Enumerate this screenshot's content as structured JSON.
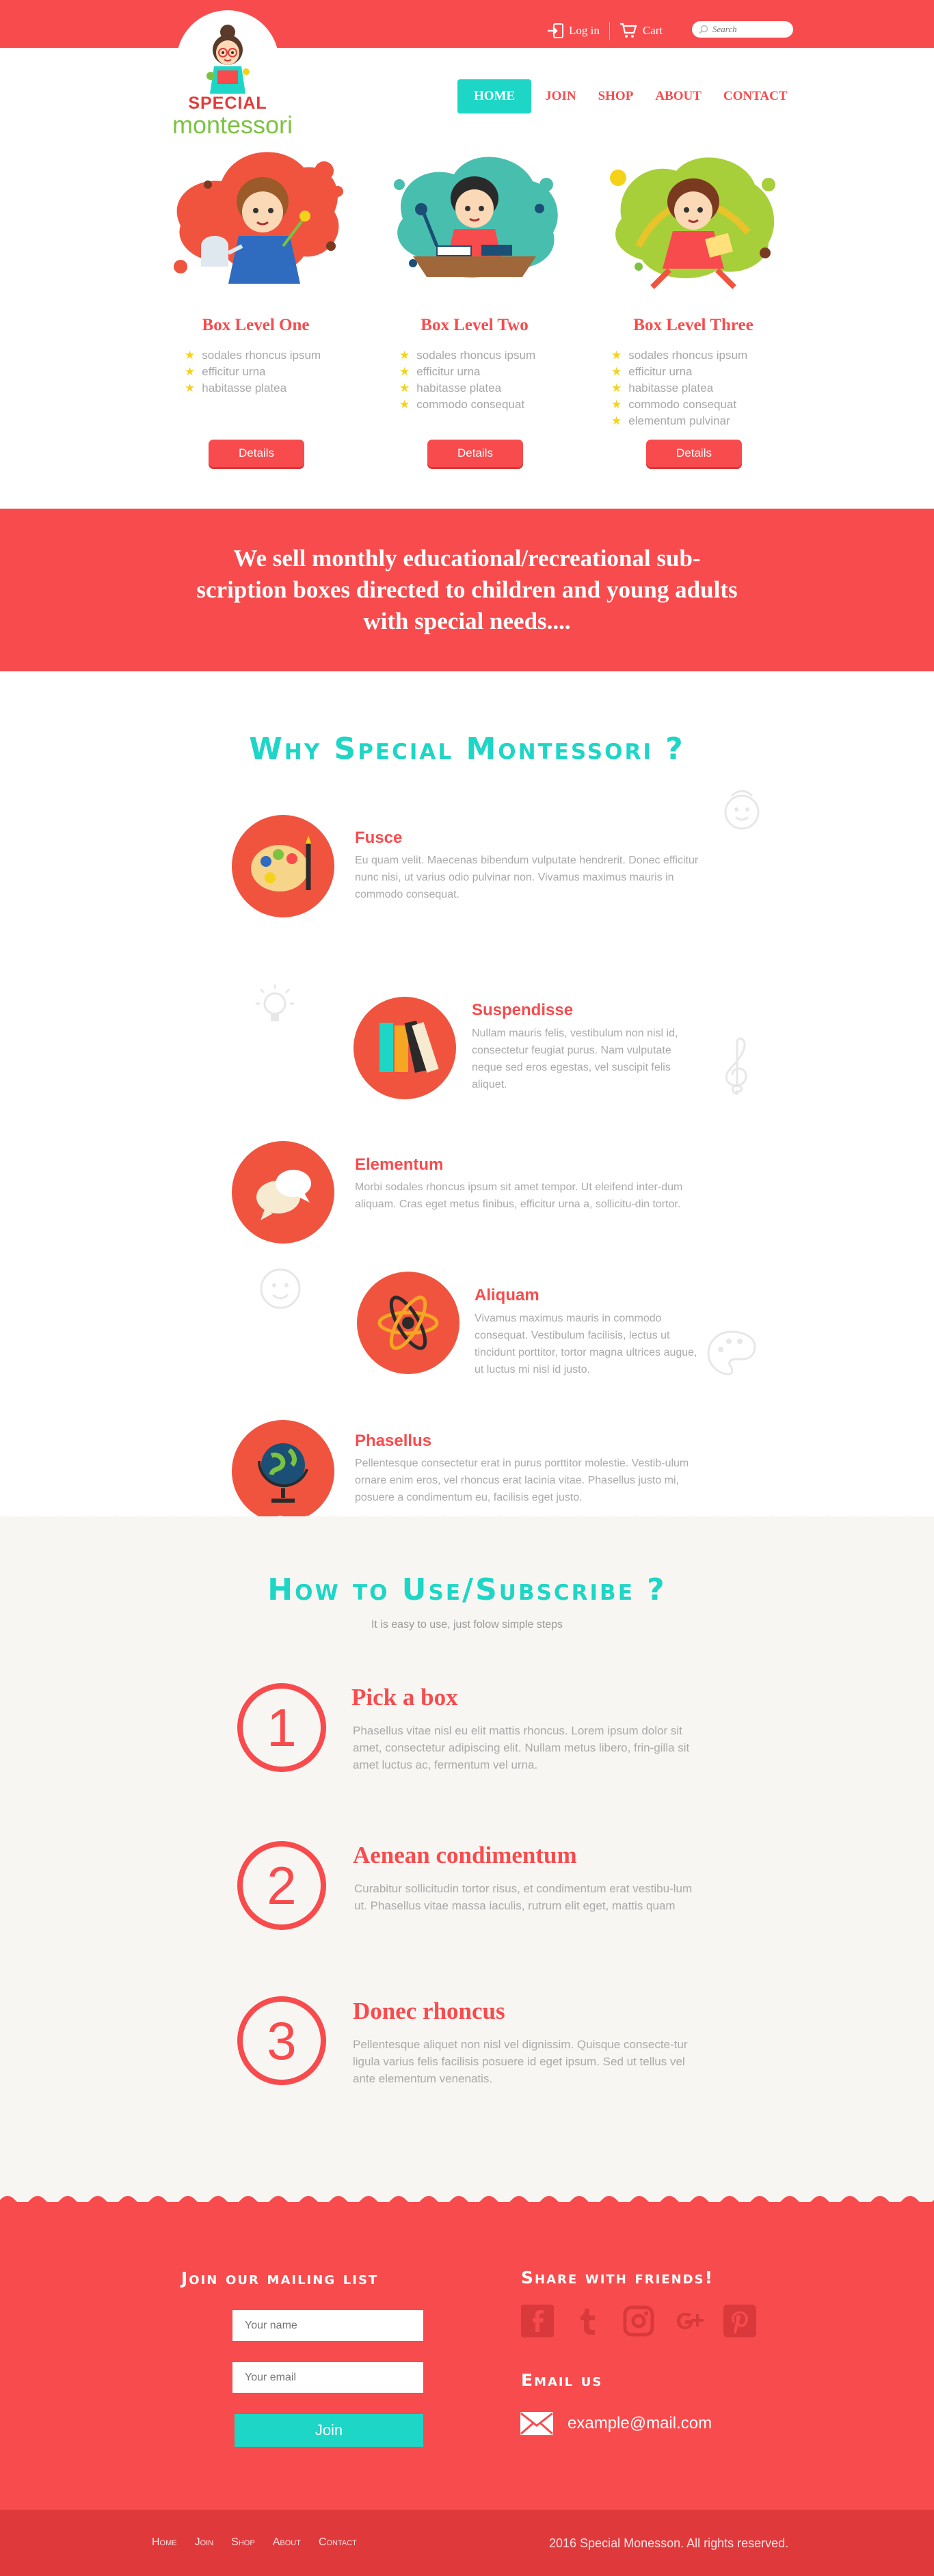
{
  "header": {
    "login_label": "Log in",
    "cart_label": "Cart",
    "search_placeholder": "Search",
    "logo_line1": "SPECIAL",
    "logo_line2": "montessori"
  },
  "nav": {
    "home": "HOME",
    "join": "JOIN",
    "shop": "SHOP",
    "about": "ABOUT",
    "contact": "CONTACT"
  },
  "boxes": [
    {
      "title": "Box Level One",
      "items": [
        "sodales rhoncus ipsum",
        "efficitur urna",
        "habitasse platea"
      ],
      "button": "Details"
    },
    {
      "title": "Box Level Two",
      "items": [
        "sodales rhoncus ipsum",
        "efficitur urna",
        "habitasse platea",
        "commodo consequat"
      ],
      "button": "Details"
    },
    {
      "title": "Box Level Three",
      "items": [
        "sodales rhoncus ipsum",
        "efficitur urna",
        "habitasse platea",
        "commodo consequat",
        "elementum pulvinar"
      ],
      "button": "Details"
    }
  ],
  "banner": {
    "text": "We sell monthly educational/recreational sub-scription boxes directed to children and young adults with special needs...."
  },
  "why": {
    "title": "Why Special Montessori ?",
    "features": [
      {
        "title": "Fusce",
        "body": "Eu quam velit. Maecenas bibendum vulputate hendrerit. Donec efficitur nunc nisi, ut varius odio pulvinar non. Vivamus maximus mauris in commodo consequat.",
        "icon": "palette-icon"
      },
      {
        "title": "Suspendisse",
        "body": "Nullam mauris felis, vestibulum non nisl id, consectetur feugiat purus. Nam vulputate neque sed eros egestas, vel suscipit felis aliquet.",
        "icon": "books-icon"
      },
      {
        "title": "Elementum",
        "body": "Morbi sodales rhoncus ipsum sit amet tempor. Ut eleifend inter-dum aliquam. Cras eget metus finibus, efficitur urna a, sollicitu-din tortor.",
        "icon": "chat-bubbles-icon"
      },
      {
        "title": "Aliquam",
        "body": "Vivamus maximus mauris in commodo consequat. Vestibulum facilisis, lectus ut tincidunt porttitor, tortor magna ultrices augue, ut luctus mi nisl id justo.",
        "icon": "atom-icon"
      },
      {
        "title": "Phasellus",
        "body": "Pellentesque consectetur erat in purus porttitor molestie. Vestib-ulum ornare enim eros, vel rhoncus erat lacinia vitae. Phasellus justo mi, posuere a condimentum eu, facilisis eget justo.",
        "icon": "globe-icon"
      }
    ]
  },
  "how": {
    "title": "How to Use/Subscribe ?",
    "subtitle": "It is easy to use, just folow simple steps",
    "steps": [
      {
        "num": "1",
        "title": "Pick a box",
        "body": "Phasellus vitae nisl eu elit mattis rhoncus. Lorem ipsum dolor sit amet, consectetur adipiscing elit. Nullam metus libero, frin-gilla sit amet luctus ac, fermentum vel urna."
      },
      {
        "num": "2",
        "title": "Aenean condimentum",
        "body": "Curabitur sollicitudin tortor risus, et condimentum erat vestibu-lum ut. Phasellus vitae massa iaculis, rutrum elit eget, mattis quam"
      },
      {
        "num": "3",
        "title": "Donec rhoncus",
        "body": "Pellentesque aliquet non nisl vel dignissim. Quisque consecte-tur ligula varius felis facilisis posuere id eget ipsum. Sed ut tellus vel ante elementum venenatis."
      }
    ]
  },
  "footer": {
    "mailing_title": "Join our mailing list",
    "name_placeholder": "Your name",
    "email_placeholder": "Your email",
    "join_label": "Join",
    "share_title": "Share with friends!",
    "social": [
      "facebook-icon",
      "tumblr-icon",
      "instagram-icon",
      "google-plus-icon",
      "pinterest-icon"
    ],
    "email_title": "Email us",
    "email": "example@mail.com",
    "bottom_nav": [
      "Home",
      "Join",
      "Shop",
      "About",
      "Contact"
    ],
    "copyright": "2016 Special Monesson. All rights reserved."
  },
  "colors": {
    "accent": "#f84b4d",
    "teal": "#1dd6c6",
    "star": "#f5d21a"
  }
}
